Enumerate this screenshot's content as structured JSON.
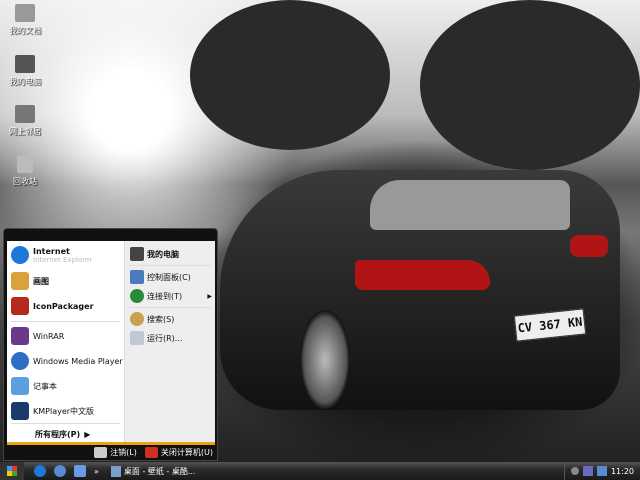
{
  "desktop": {
    "icons": [
      {
        "label": "我的文档",
        "icon": "folder-icon"
      },
      {
        "label": "我的电脑",
        "icon": "computer-icon"
      },
      {
        "label": "网上邻居",
        "icon": "network-icon"
      },
      {
        "label": "回收站",
        "icon": "recycle-bin-icon"
      }
    ],
    "wallpaper": {
      "plate": "CV 367 KN"
    }
  },
  "start_menu": {
    "pinned": [
      {
        "label": "Internet",
        "sub": "Internet Explorer",
        "icon": "ie-icon",
        "color": "#1e78d8"
      },
      {
        "label": "画图",
        "icon": "paint-icon",
        "color": "#d9a33a"
      },
      {
        "label": "IconPackager",
        "icon": "iconpackager-icon",
        "color": "#b52a1c"
      }
    ],
    "recent": [
      {
        "label": "WinRAR",
        "icon": "winrar-icon",
        "color": "#6a3a8a"
      },
      {
        "label": "Windows Media Player",
        "icon": "media-player-icon",
        "color": "#2d6fc4"
      },
      {
        "label": "记事本",
        "icon": "notepad-icon",
        "color": "#5aa0e0"
      },
      {
        "label": "KMPlayer中文版",
        "icon": "kmplayer-icon",
        "color": "#1a3a6a"
      }
    ],
    "all_programs": "所有程序(P)",
    "right": [
      {
        "label": "我的电脑",
        "icon": "computer-icon",
        "bold": true
      },
      {
        "label": "控制面板(C)",
        "icon": "control-panel-icon"
      },
      {
        "label": "连接到(T)",
        "icon": "connect-icon",
        "arrow": true
      },
      {
        "label": "搜索(S)",
        "icon": "search-icon"
      },
      {
        "label": "运行(R)...",
        "icon": "run-icon"
      }
    ],
    "logoff": "注销(L)",
    "shutdown": "关闭计算机(U)",
    "accent": "#e8a317"
  },
  "taskbar": {
    "task": "桌面 - 壁纸 - 桌酷...",
    "clock": "11:20",
    "overflow": "»"
  }
}
